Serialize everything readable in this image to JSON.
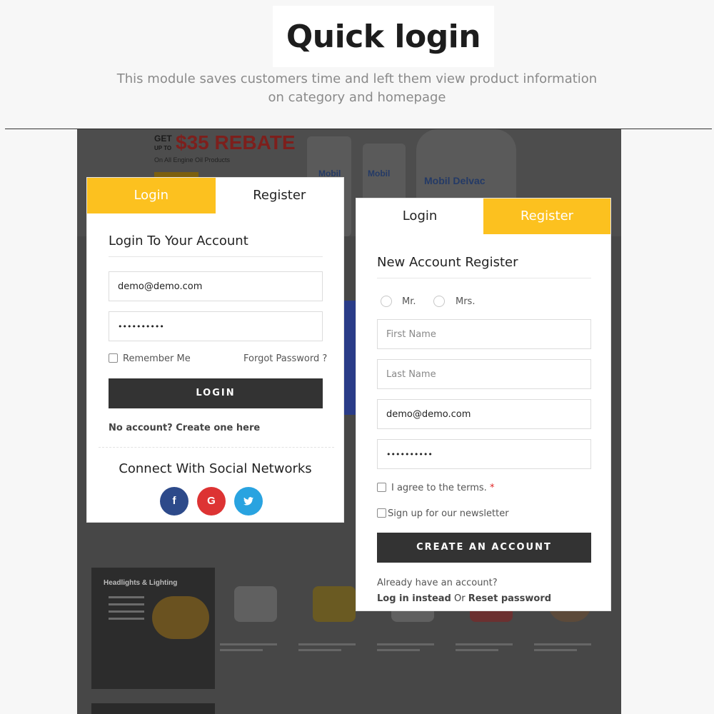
{
  "header": {
    "title": "Quick login",
    "subtitle": "This module saves customers time and left them view product information on category and homepage"
  },
  "promo": {
    "get": "GET",
    "upto": "UP TO",
    "rebate": "$35 REBATE",
    "sub": "On All Engine Oil Products",
    "can_labels": [
      "Mobil",
      "Mobil",
      "Mobil Delvac"
    ]
  },
  "background_tiles": {
    "lights_title": "Headlights & Lighting"
  },
  "login": {
    "tabs": [
      {
        "label": "Login",
        "active": true
      },
      {
        "label": "Register",
        "active": false
      }
    ],
    "heading": "Login To Your Account",
    "email_value": "demo@demo.com",
    "password_value": "••••••••••",
    "remember_label": "Remember Me",
    "forgot_label": "Forgot Password ?",
    "submit_label": "LOGIN",
    "no_account_label": "No account? Create one here",
    "social_heading": "Connect With Social Networks",
    "social": [
      {
        "name": "facebook-icon",
        "glyph": "f",
        "color": "#2d4a8a"
      },
      {
        "name": "google-icon",
        "glyph": "G",
        "color": "#dd3333"
      },
      {
        "name": "twitter-icon",
        "glyph": "t",
        "color": "#29a3e0"
      }
    ]
  },
  "register": {
    "tabs": [
      {
        "label": "Login",
        "active": false
      },
      {
        "label": "Register",
        "active": true
      }
    ],
    "heading": "New Account Register",
    "title_options": [
      "Mr.",
      "Mrs."
    ],
    "first_name_placeholder": "First Name",
    "last_name_placeholder": "Last Name",
    "email_value": "demo@demo.com",
    "password_value": "••••••••••",
    "terms_label": "I agree to the terms.",
    "terms_required_mark": "*",
    "newsletter_label": "Sign up for our newsletter",
    "submit_label": "CREATE AN ACCOUNT",
    "already_label": "Already have an account?",
    "login_instead_label": "Log in instead",
    "or_label": "Or",
    "reset_label": "Reset password"
  },
  "colors": {
    "accent": "#fcc11f",
    "dark_button": "#333333",
    "required": "#e02424"
  }
}
